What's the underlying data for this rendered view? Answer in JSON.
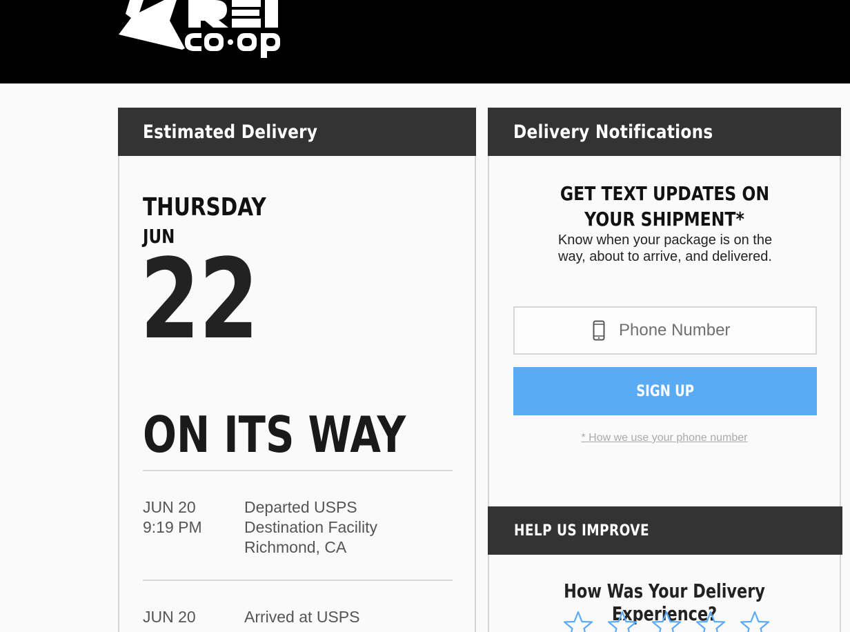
{
  "header": {
    "logo_alt": "REI co-op"
  },
  "estimated_delivery": {
    "title": "Estimated Delivery",
    "day": "THURSDAY",
    "month": "JUN",
    "date": "22",
    "status": "ON ITS WAY",
    "events": [
      {
        "date": "JUN 20",
        "time": "9:19 PM",
        "line1": "Departed USPS",
        "line2": "Destination Facility",
        "line3": "Richmond, CA"
      },
      {
        "date": "JUN 20",
        "line1": "Arrived at USPS"
      }
    ]
  },
  "notifications": {
    "title": "Delivery Notifications",
    "promo_line1": "GET TEXT UPDATES ON",
    "promo_line2": "YOUR SHIPMENT*",
    "promo_text": "Know when your package is on the way, about to arrive, and delivered.",
    "phone_placeholder": "Phone Number",
    "signup_label": "SIGN UP",
    "phone_link": "* How we use your phone number",
    "icons": {
      "phone": "mobile-phone-icon",
      "rating": "star-outline-icon"
    }
  },
  "help": {
    "title": "HELP US IMPROVE",
    "question": "How Was Your Delivery Experience?",
    "rating": 0,
    "rating_max": 5
  },
  "colors": {
    "header_bg": "#000000",
    "card_head_bg": "#333333",
    "signup_button": "#5aabf5",
    "star_outline": "#5aabf5"
  }
}
